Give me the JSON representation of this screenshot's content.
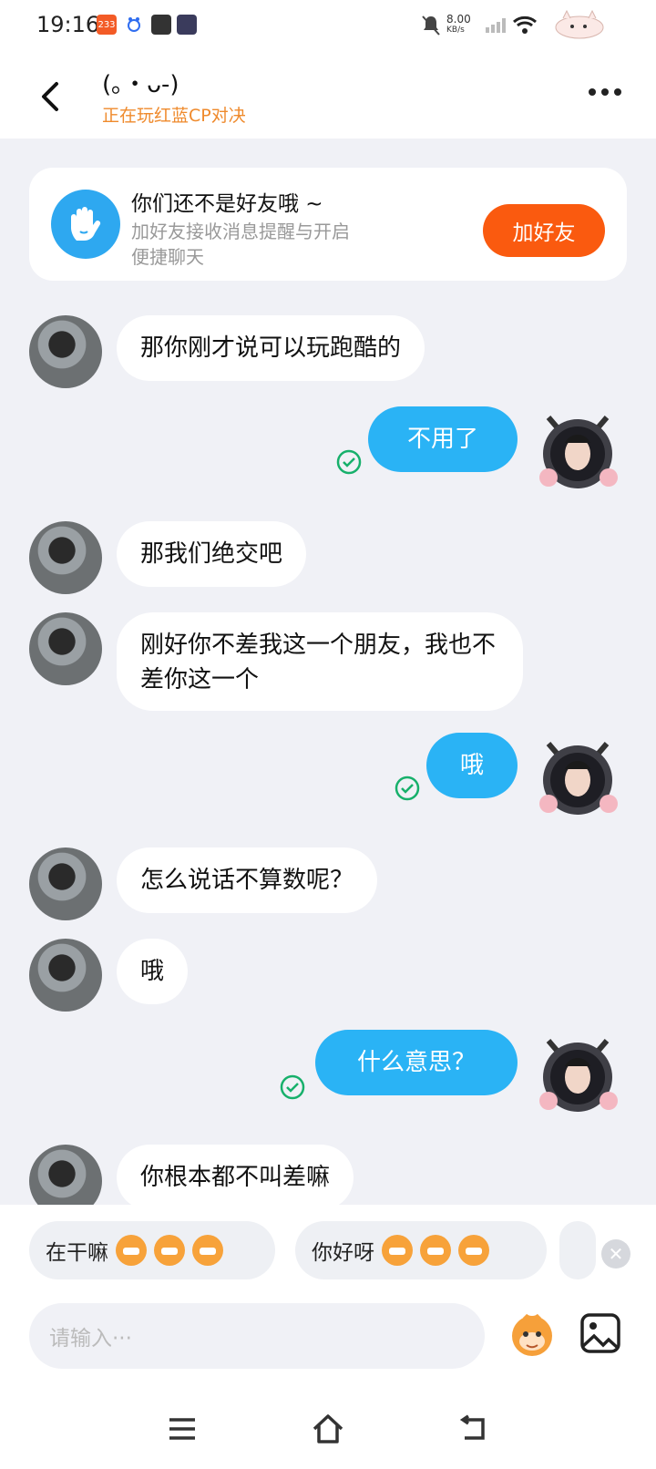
{
  "status": {
    "time": "19:16",
    "net_speed": "8.00",
    "net_unit": "KB/s",
    "app_badge": "233"
  },
  "header": {
    "title": "(｡・ᴗ-)",
    "subtitle": "正在玩红蓝CP对决"
  },
  "friend_card": {
    "title": "你们还不是好友哦 ~",
    "desc": "加好友接收消息提醒与开启便捷聊天",
    "button": "加好友"
  },
  "messages": [
    {
      "side": "left",
      "text": "那你刚才说可以玩跑酷的"
    },
    {
      "side": "right",
      "text": "不用了"
    },
    {
      "side": "left",
      "text": "那我们绝交吧"
    },
    {
      "side": "left",
      "text": "刚好你不差我这一个朋友，我也不差你这一个"
    },
    {
      "side": "right",
      "text": "哦"
    },
    {
      "side": "left",
      "text": "怎么说话不算数呢？"
    },
    {
      "side": "left",
      "text": "哦"
    },
    {
      "side": "right",
      "text": "什么意思？"
    },
    {
      "side": "left",
      "text": "你根本都不叫差嘛"
    }
  ],
  "quick_replies": [
    {
      "text": "在干嘛"
    },
    {
      "text": "你好呀"
    }
  ],
  "input": {
    "placeholder": "请输入···"
  },
  "colors": {
    "accent_orange": "#fa5a0f",
    "bubble_blue": "#2ab3f5",
    "subtitle_orange": "#ef8a2c",
    "check_green": "#17b06b"
  }
}
